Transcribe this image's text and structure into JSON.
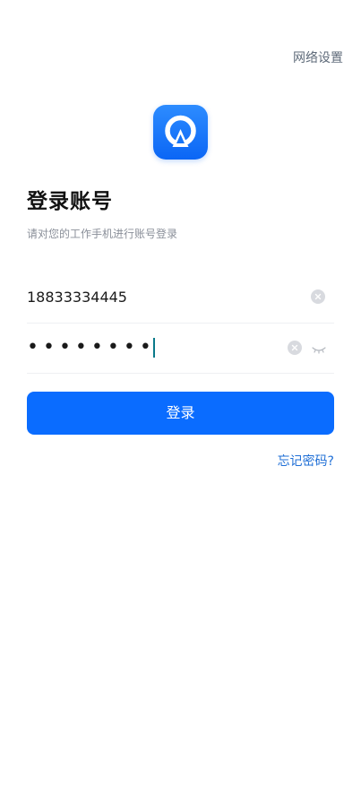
{
  "header": {
    "network_settings_label": "网络设置"
  },
  "logo": {
    "icon": "app-logo-icon",
    "color": "#0b66f5"
  },
  "login": {
    "title": "登录账号",
    "subtitle": "请对您的工作手机进行账号登录"
  },
  "form": {
    "phone_value": "18833334445",
    "password_masked": "••••••••",
    "clear_icon": "clear-icon",
    "visibility_icon": "eye-closed-icon"
  },
  "actions": {
    "login_label": "登录",
    "forgot_password_label": "忘记密码?",
    "primary_color": "#0a6cff"
  }
}
